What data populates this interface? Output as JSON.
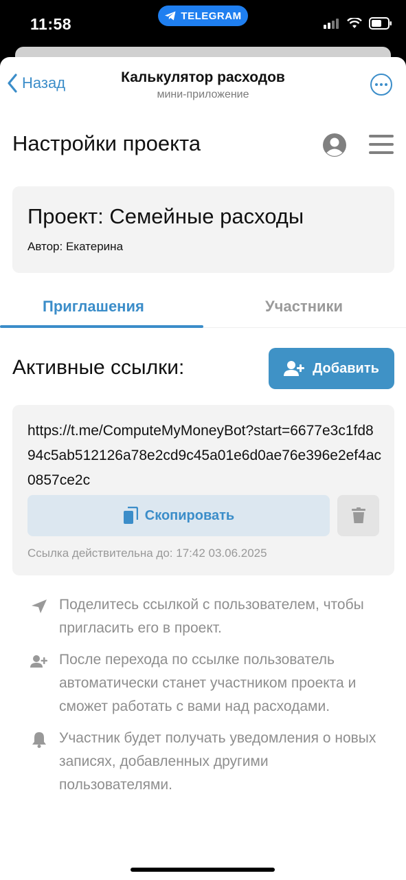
{
  "status_bar": {
    "time": "11:58",
    "pill_label": "TELEGRAM"
  },
  "nav": {
    "back_label": "Назад",
    "title": "Калькулятор расходов",
    "subtitle": "мини-приложение"
  },
  "page": {
    "title": "Настройки проекта"
  },
  "project": {
    "name": "Проект: Семейные расходы",
    "author": "Автор: Екатерина"
  },
  "tabs": [
    {
      "label": "Приглашения",
      "active": true
    },
    {
      "label": "Участники",
      "active": false
    }
  ],
  "links": {
    "title": "Активные ссылки:",
    "add_label": "Добавить",
    "items": [
      {
        "url": "https://t.me/ComputeMyMoneyBot?start=6677e3c1fd894c5ab512126a78e2cd9c45a01e6d0ae76e396e2ef4ac0857ce2c",
        "copy_label": "Скопировать",
        "expiry": "Ссылка действительна до: 17:42 03.06.2025"
      }
    ]
  },
  "tips": [
    {
      "icon": "paper-plane-icon",
      "text": "Поделитесь ссылкой с пользователем, чтобы пригласить его в проект."
    },
    {
      "icon": "user-plus-icon",
      "text": "После перехода по ссылке пользователь автоматически станет участником проекта и сможет работать с вами над расходами."
    },
    {
      "icon": "bell-icon",
      "text": "Участник будет получать уведомления о новых записях, добавленных другими пользователями."
    }
  ],
  "colors": {
    "accent": "#3b8dc9",
    "button_bg": "#3f92c6",
    "card_bg": "#f3f3f3",
    "muted_text": "#8e8e8e",
    "telegram_pill": "#1f7ff0"
  }
}
